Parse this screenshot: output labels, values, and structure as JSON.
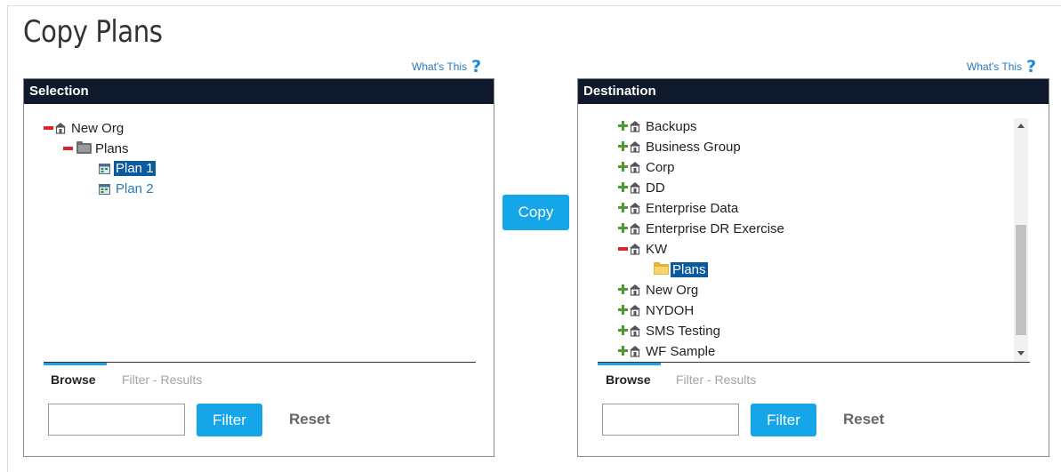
{
  "page": {
    "title": "Copy Plans"
  },
  "help": {
    "label": "What's This",
    "icon": "?"
  },
  "selection": {
    "header": "Selection",
    "tree": [
      {
        "label": "New Org",
        "toggle": "minus",
        "icon": "org-icon",
        "level": 0
      },
      {
        "label": "Plans",
        "toggle": "minus",
        "icon": "folder-icon",
        "level": 1
      },
      {
        "label": "Plan 1",
        "icon": "plan-icon",
        "level": 2,
        "selected": true
      },
      {
        "label": "Plan 2",
        "icon": "plan-icon",
        "level": 2,
        "link": true
      }
    ],
    "tabs": [
      "Browse",
      "Filter - Results"
    ],
    "filter_value": "",
    "filter_button": "Filter",
    "reset_button": "Reset"
  },
  "copy_button": "Copy",
  "destination": {
    "header": "Destination",
    "tree": [
      {
        "label": "Backups",
        "toggle": "plus",
        "icon": "org-icon",
        "level": 0
      },
      {
        "label": "Business Group",
        "toggle": "plus",
        "icon": "org-icon",
        "level": 0
      },
      {
        "label": "Corp",
        "toggle": "plus",
        "icon": "org-icon",
        "level": 0
      },
      {
        "label": "DD",
        "toggle": "plus",
        "icon": "org-icon",
        "level": 0
      },
      {
        "label": "Enterprise Data",
        "toggle": "plus",
        "icon": "org-icon",
        "level": 0
      },
      {
        "label": "Enterprise DR Exercise",
        "toggle": "plus",
        "icon": "org-icon",
        "level": 0
      },
      {
        "label": "KW",
        "toggle": "minus",
        "icon": "org-icon",
        "level": 0
      },
      {
        "label": "Plans",
        "icon": "folder-icon-open",
        "level": 1,
        "selected": true
      },
      {
        "label": "New Org",
        "toggle": "plus",
        "icon": "org-icon",
        "level": 0
      },
      {
        "label": "NYDOH",
        "toggle": "plus",
        "icon": "org-icon",
        "level": 0
      },
      {
        "label": "SMS Testing",
        "toggle": "plus",
        "icon": "org-icon",
        "level": 0
      },
      {
        "label": "WF Sample",
        "toggle": "plus",
        "icon": "org-icon",
        "level": 0
      }
    ],
    "tabs": [
      "Browse",
      "Filter - Results"
    ],
    "filter_value": "",
    "filter_button": "Filter",
    "reset_button": "Reset"
  },
  "colors": {
    "header_bg": "#0e1a2b",
    "accent": "#14a6e8",
    "selected": "#0a5aa0",
    "link": "#2a7ab8"
  }
}
